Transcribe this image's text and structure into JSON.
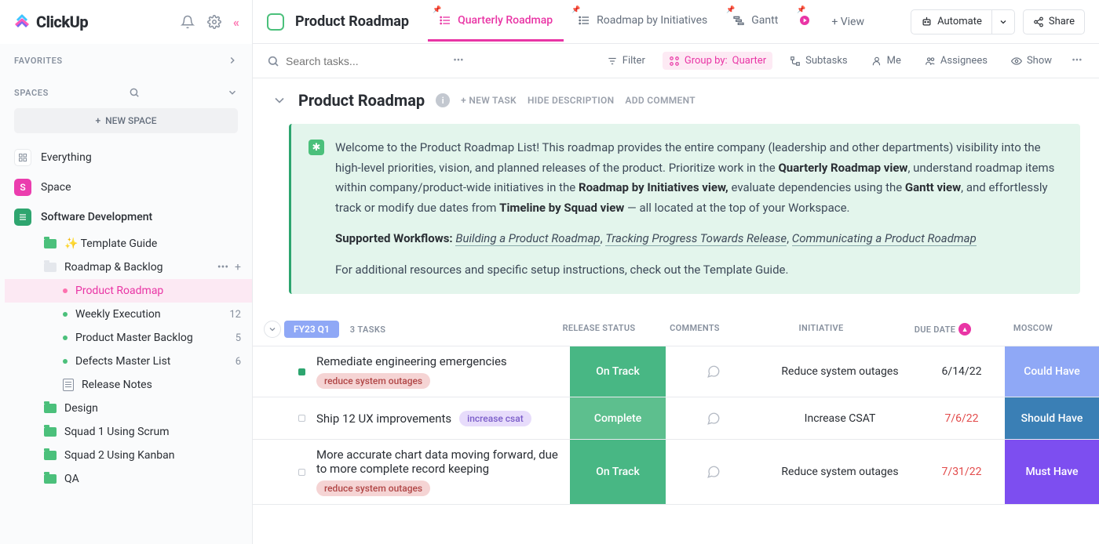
{
  "brand": "ClickUp",
  "sidebar": {
    "favorites_label": "FAVORITES",
    "spaces_label": "SPACES",
    "new_space_label": "NEW SPACE",
    "everything_label": "Everything",
    "space_label": "Space",
    "softdev_label": "Software Development",
    "template_guide_label": "✨ Template Guide",
    "roadmap_backlog_label": "Roadmap & Backlog",
    "product_roadmap_label": "Product Roadmap",
    "weekly_execution_label": "Weekly Execution",
    "weekly_execution_count": "12",
    "product_master_label": "Product Master Backlog",
    "product_master_count": "5",
    "defects_label": "Defects Master List",
    "defects_count": "6",
    "release_notes_label": "Release Notes",
    "design_label": "Design",
    "squad1_label": "Squad 1 Using Scrum",
    "squad2_label": "Squad 2 Using Kanban",
    "qa_label": "QA"
  },
  "topbar": {
    "breadcrumb": "Product Roadmap",
    "tab_quarterly": "Quarterly Roadmap",
    "tab_initiatives": "Roadmap by Initiatives",
    "tab_gantt": "Gantt",
    "plus_view": "+ View",
    "automate": "Automate",
    "share": "Share"
  },
  "filterbar": {
    "search_placeholder": "Search tasks...",
    "filter": "Filter",
    "group_by_label": "Group by:",
    "group_by_value": "Quarter",
    "subtasks": "Subtasks",
    "me": "Me",
    "assignees": "Assignees",
    "show": "Show"
  },
  "page": {
    "title": "Product Roadmap",
    "new_task": "+ NEW TASK",
    "hide_desc": "HIDE DESCRIPTION",
    "add_comment": "ADD COMMENT"
  },
  "description": {
    "p1_a": "Welcome to the Product Roadmap List! This roadmap provides the entire company (leadership and other departments) visibility into the high-level priorities, vision, and planned releases of the product. Prioritize work in the ",
    "p1_b1": "Quarterly Roadmap view",
    "p1_c": ", understand roadmap items within company/product-wide initiatives in the ",
    "p1_b2": "Roadmap by Initiatives view,",
    "p1_d": " evaluate dependencies using the ",
    "p1_b3": "Gantt view",
    "p1_e": ", and effortlessly track or modify due dates from ",
    "p1_b4": "Timeline by Squad view",
    "p1_f": " — all located at the top of your Workspace.",
    "p2_label": "Supported Workflows:",
    "p2_w1": "Building a Product Roadmap",
    "p2_w2": "Tracking Progress Towards Release",
    "p2_w3": "Communicating a Product Roadmap",
    "p3": "For additional resources and specific setup instructions, check out the Template Guide."
  },
  "group": {
    "label": "FY23 Q1",
    "count": "3 TASKS",
    "col_status": "RELEASE STATUS",
    "col_comments": "COMMENTS",
    "col_initiative": "INITIATIVE",
    "col_due": "DUE DATE",
    "col_moscow": "MOSCOW"
  },
  "tasks": [
    {
      "title": "Remediate engineering emergencies",
      "tag": "reduce system outages",
      "tag_style": "red",
      "status": "On Track",
      "status_style": "ontrack",
      "initiative": "Reduce system outages",
      "due": "6/14/22",
      "due_red": false,
      "moscow": "Could Have",
      "moscow_style": "could",
      "square": "green"
    },
    {
      "title": "Ship 12 UX improvements",
      "tag": "increase csat",
      "tag_style": "purple",
      "status": "Complete",
      "status_style": "complete",
      "initiative": "Increase CSAT",
      "due": "7/6/22",
      "due_red": true,
      "moscow": "Should Have",
      "moscow_style": "should",
      "square": ""
    },
    {
      "title": "More accurate chart data moving forward, due to more complete record keeping",
      "tag": "reduce system outages",
      "tag_style": "red",
      "status": "On Track",
      "status_style": "ontrack",
      "initiative": "Reduce system outages",
      "due": "7/31/22",
      "due_red": true,
      "moscow": "Must Have",
      "moscow_style": "must",
      "square": ""
    }
  ]
}
